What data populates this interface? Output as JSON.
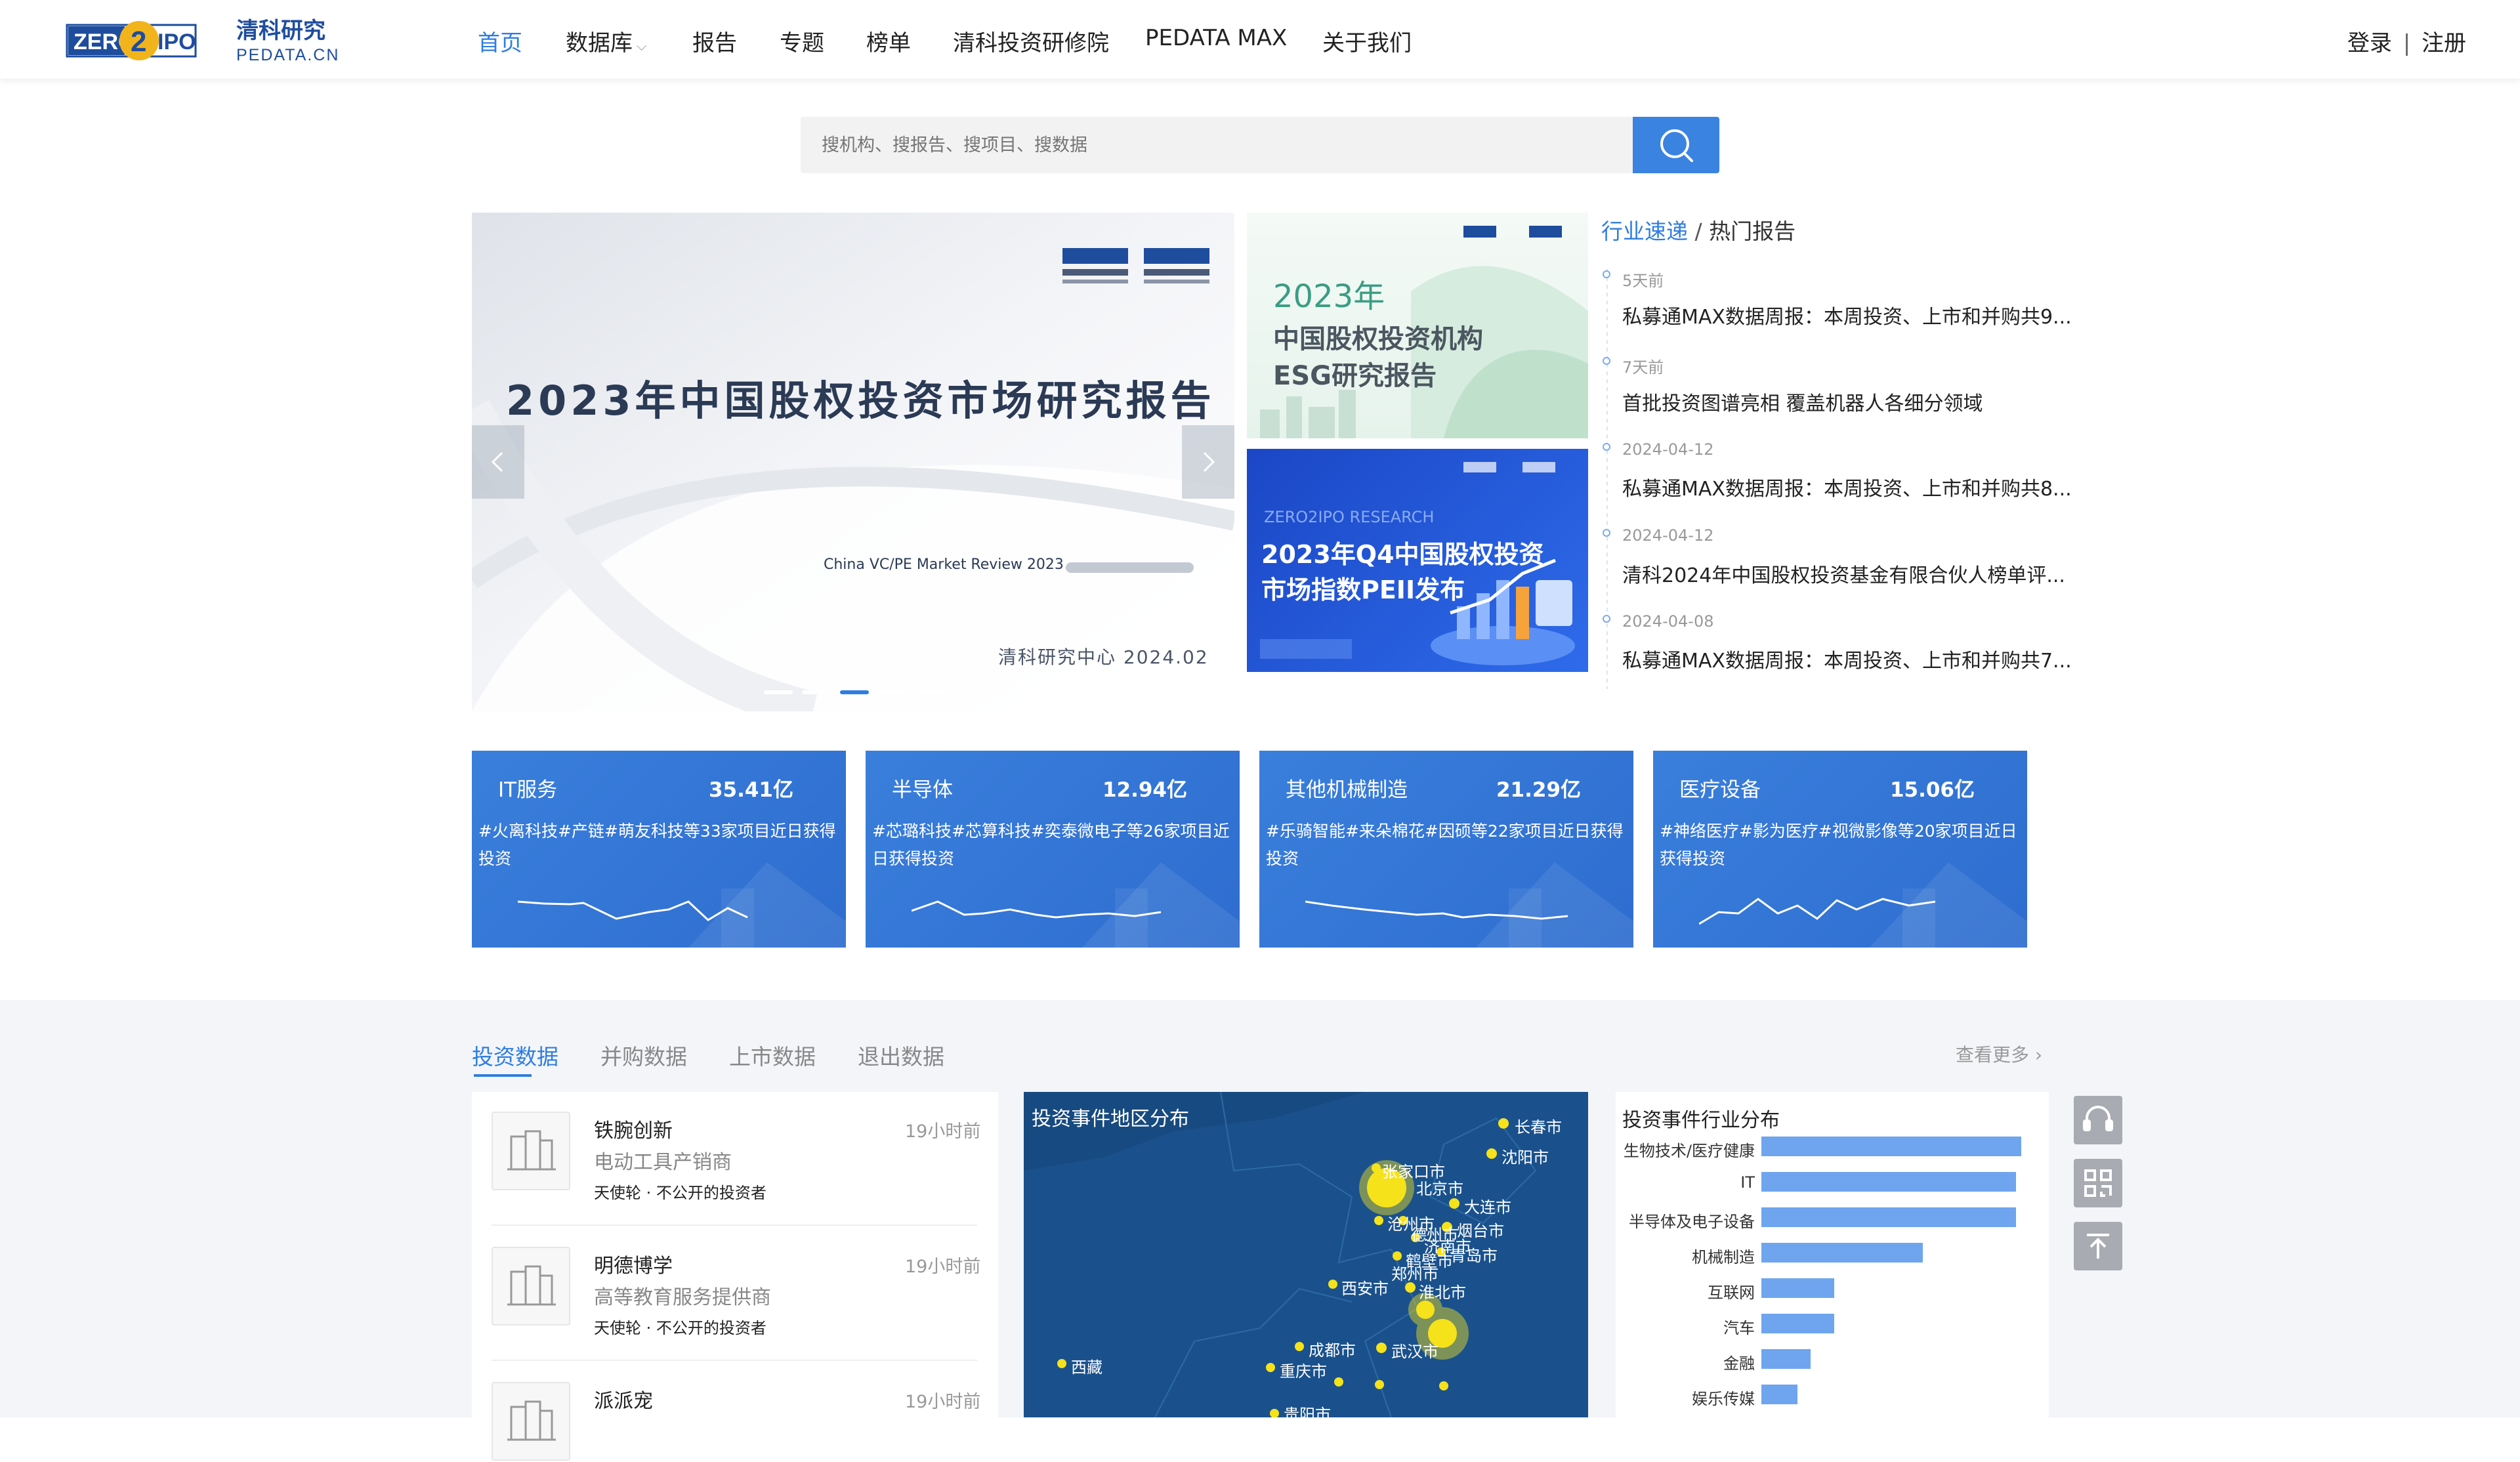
{
  "header": {
    "logo_left": "ZERO",
    "logo_mid": "2",
    "logo_right": "IPO",
    "logo_cn": "清科研究",
    "logo_domain": "PEDATA.CN",
    "nav": [
      "首页",
      "数据库",
      "报告",
      "专题",
      "榜单",
      "清科投资研修院",
      "PEDATA MAX",
      "关于我们"
    ],
    "active_nav": "首页",
    "login": "登录",
    "divider": "|",
    "register": "注册"
  },
  "search": {
    "placeholder": "搜机构、搜报告、搜项目、搜数据"
  },
  "banner": {
    "headline": "2023年中国股权投资市场研究报告",
    "subtitle_en": "China VC/PE Market Review 2023",
    "footer": "清科研究中心 2024.02",
    "slide_count": 5,
    "active_slide": 3
  },
  "side_cards": {
    "card1_year": "2023年",
    "card1_line1": "中国股权投资机构",
    "card1_line2": "ESG研究报告",
    "card2_tag": "ZERO2IPO RESEARCH",
    "card2_line1": "2023年Q4中国股权投资",
    "card2_line2": "市场指数PEII发布"
  },
  "news": {
    "tab_active": "行业速递",
    "tab_sep": "/",
    "tab_other": "热门报告",
    "items": [
      {
        "date": "5天前",
        "title": "私募通MAX数据周报：本周投资、上市和并购共9..."
      },
      {
        "date": "7天前",
        "title": "首批投资图谱亮相 覆盖机器人各细分领域"
      },
      {
        "date": "2024-04-12",
        "title": "私募通MAX数据周报：本周投资、上市和并购共8..."
      },
      {
        "date": "2024-04-12",
        "title": "清科2024年中国股权投资基金有限合伙人榜单评..."
      },
      {
        "date": "2024-04-08",
        "title": "私募通MAX数据周报：本周投资、上市和并购共7..."
      }
    ]
  },
  "industry_cards": [
    {
      "name": "IT服务",
      "amount": "35.41亿",
      "desc": "#火离科技#产链#萌友科技等33家项目近日获得投资"
    },
    {
      "name": "半导体",
      "amount": "12.94亿",
      "desc": "#芯璐科技#芯算科技#奕泰微电子等26家项目近日获得投资"
    },
    {
      "name": "其他机械制造",
      "amount": "21.29亿",
      "desc": "#乐骑智能#来朵棉花#因硕等22家项目近日获得投资"
    },
    {
      "name": "医疗设备",
      "amount": "15.06亿",
      "desc": "#神络医疗#影为医疗#视微影像等20家项目近日获得投资"
    }
  ],
  "lower": {
    "tabs": [
      "投资数据",
      "并购数据",
      "上市数据",
      "退出数据"
    ],
    "active_tab": "投资数据",
    "more": "查看更多 ›",
    "deals": [
      {
        "name": "铁腕创新",
        "desc": "电动工具产销商",
        "round": "天使轮 · 不公开的投资者",
        "time": "19小时前"
      },
      {
        "name": "明德博学",
        "desc": "高等教育服务提供商",
        "round": "天使轮 · 不公开的投资者",
        "time": "19小时前"
      },
      {
        "name": "派派宠",
        "desc": "",
        "round": "",
        "time": "19小时前"
      }
    ],
    "map": {
      "title": "投资事件地区分布",
      "cities": [
        "长春市",
        "沈阳市",
        "张家口市",
        "北京市",
        "大连市",
        "烟台市",
        "沧州市",
        "德州市",
        "济南市",
        "青岛市",
        "鹤壁市",
        "郑州市",
        "西安市",
        "淮北市",
        "成都市",
        "重庆市",
        "武汉市",
        "西藏",
        "贵阳市"
      ]
    },
    "industry_chart": {
      "title": "投资事件行业分布",
      "categories": [
        "生物技术/医疗健康",
        "IT",
        "半导体及电子设备",
        "机械制造",
        "互联网",
        "汽车",
        "金融",
        "娱乐传媒"
      ]
    }
  },
  "chart_data": {
    "type": "bar",
    "title": "投资事件行业分布",
    "categories": [
      "生物技术/医疗健康",
      "IT",
      "半导体及电子设备",
      "机械制造",
      "互联网",
      "汽车",
      "金融",
      "娱乐传媒"
    ],
    "values": [
      100,
      98,
      98,
      62,
      28,
      28,
      19,
      14
    ],
    "orientation": "horizontal",
    "xlabel": "",
    "ylabel": "",
    "color": "#6ea5ee"
  },
  "colors": {
    "accent": "#2f7de1",
    "card_blue": "#3a7fdc",
    "map_bg": "#174a80",
    "city_dot": "#f6e21b"
  }
}
